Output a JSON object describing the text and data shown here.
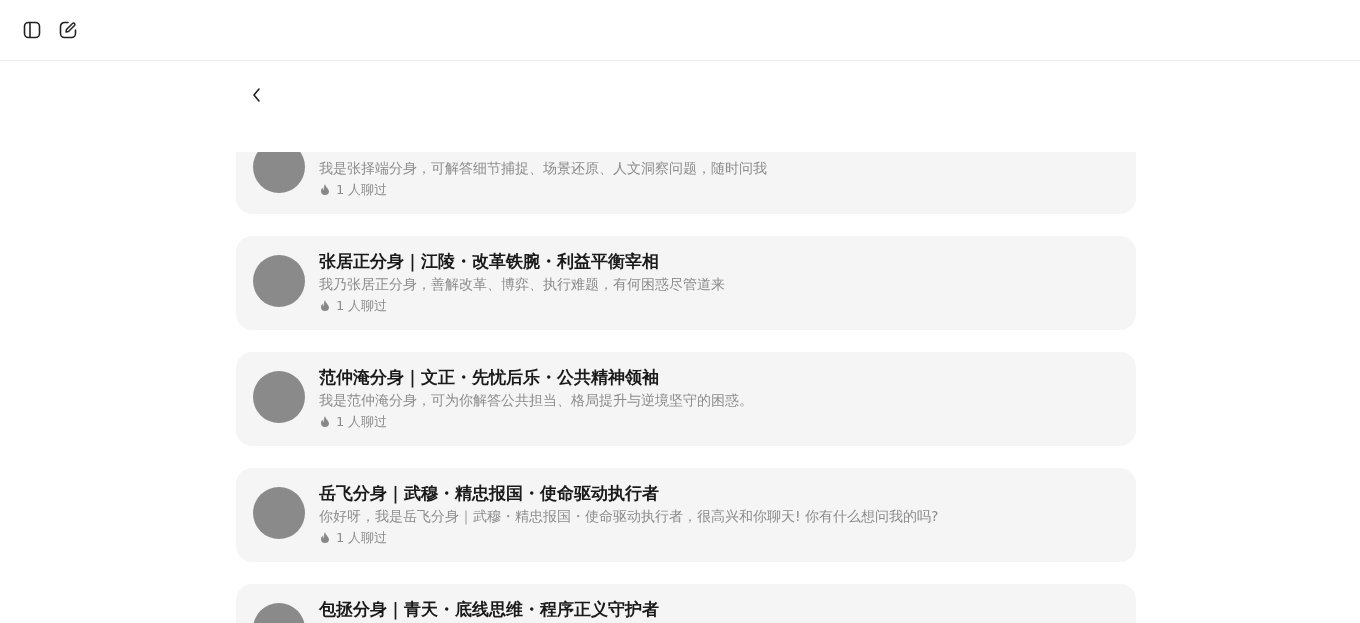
{
  "agents": [
    {
      "description": "我是张择端分身，可解答细节捕捉、场景还原、人文洞察问题，随时问我",
      "chat_count": "1 人聊过"
    },
    {
      "name": "张居正分身｜江陵・改革铁腕・利益平衡宰相",
      "description": "我乃张居正分身，善解改革、博弈、执行难题，有何困惑尽管道来",
      "chat_count": "1 人聊过"
    },
    {
      "name": "范仲淹分身｜文正・先忧后乐・公共精神领袖",
      "description": "我是范仲淹分身，可为你解答公共担当、格局提升与逆境坚守的困惑。",
      "chat_count": "1 人聊过"
    },
    {
      "name": "岳飞分身｜武穆・精忠报国・使命驱动执行者",
      "description": "你好呀，我是岳飞分身｜武穆・精忠报国・使命驱动执行者，很高兴和你聊天! 你有什么想问我的吗?",
      "chat_count": "1 人聊过"
    },
    {
      "name": "包拯分身｜青天・底线思维・程序正义守护者"
    }
  ]
}
